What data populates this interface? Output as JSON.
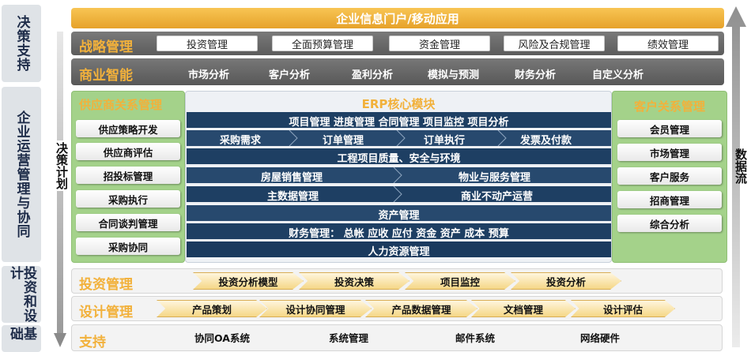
{
  "side_labels": {
    "decision": "决策支持",
    "operations": "企业运营管理与协同",
    "invest_design": "投资和设计",
    "base": "基础"
  },
  "inner_left_label": "决策计划",
  "right_label": "数据流",
  "portal": "企业信息门户/移动应用",
  "strategy": {
    "title": "战略管理",
    "items": [
      "投资管理",
      "全面预算管理",
      "资金管理",
      "风险及合规管理",
      "绩效管理"
    ]
  },
  "bi": {
    "title": "商业智能",
    "items": [
      "市场分析",
      "客户分析",
      "盈利分析",
      "模拟与预测",
      "财务分析",
      "自定义分析"
    ]
  },
  "supplier": {
    "title": "供应商关系管理",
    "items": [
      "供应策略开发",
      "供应商评估",
      "招投标管理",
      "采购执行",
      "合同谈判管理",
      "采购协同"
    ]
  },
  "erp": {
    "title": "ERP核心模块",
    "row1": "项目管理 进度管理 合同管理 项目监控 项目分析",
    "row2": [
      "采购需求",
      "订单管理",
      "订单执行",
      "发票及付款"
    ],
    "row3": "工程项目质量、安全与环境",
    "row4": [
      "房屋销售管理",
      "物业与服务管理"
    ],
    "row5": [
      "主数据管理",
      "商业不动产运营"
    ],
    "row6": "资产管理",
    "row7": "财务管理： 总帐 应收 应付 资金 资产 成本 预算",
    "row8": "人力资源管理"
  },
  "customer": {
    "title": "客户关系管理",
    "items": [
      "会员管理",
      "市场管理",
      "客户服务",
      "招商管理",
      "综合分析"
    ]
  },
  "invest": {
    "title": "投资管理",
    "items": [
      "投资分析模型",
      "投资决策",
      "项目监控",
      "投资分析"
    ]
  },
  "design": {
    "title": "设计管理",
    "items": [
      "产品策划",
      "设计协同管理",
      "产品数据管理",
      "文档管理",
      "设计评估"
    ]
  },
  "support": {
    "title": "支持",
    "items": [
      "协同OA系统",
      "系统管理",
      "邮件系统",
      "网络硬件"
    ]
  },
  "colors": {
    "gold": "#f2b13b",
    "navy": "#1e3f63",
    "green": "#9fcf7f",
    "gray_band": "#6e6e6e"
  }
}
